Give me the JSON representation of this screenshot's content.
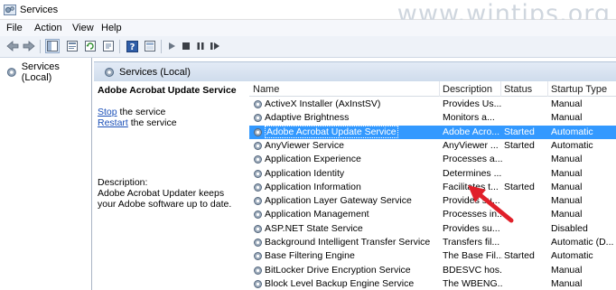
{
  "window": {
    "title": "Services",
    "watermark": "www.wintips.org"
  },
  "menu": {
    "items": [
      "File",
      "Action",
      "View",
      "Help"
    ]
  },
  "toolbar": {
    "buttons": [
      "back-icon",
      "forward-icon",
      "show-hide-tree-icon",
      "properties-icon",
      "refresh-icon",
      "export-list-icon",
      "help-icon",
      "console-tree-icon",
      "start-service-icon",
      "stop-service-icon",
      "pause-service-icon",
      "restart-service-icon"
    ]
  },
  "tree": {
    "root_label": "Services (Local)"
  },
  "main": {
    "header": "Services (Local)",
    "detail": {
      "service_title": "Adobe Acrobat Update Service",
      "stop_link": "Stop",
      "stop_suffix": " the service",
      "restart_link": "Restart",
      "restart_suffix": " the service",
      "description_label": "Description:",
      "description": "Adobe Acrobat Updater keeps your Adobe software up to date."
    },
    "columns": {
      "name": "Name",
      "description": "Description",
      "status": "Status",
      "startup": "Startup Type"
    },
    "rows": [
      {
        "name": "ActiveX Installer (AxInstSV)",
        "description": "Provides Us...",
        "status": "",
        "startup": "Manual"
      },
      {
        "name": "Adaptive Brightness",
        "description": "Monitors a...",
        "status": "",
        "startup": "Manual"
      },
      {
        "name": "Adobe Acrobat Update Service",
        "description": "Adobe Acro...",
        "status": "Started",
        "startup": "Automatic",
        "selected": true
      },
      {
        "name": "AnyViewer Service",
        "description": "AnyViewer ...",
        "status": "Started",
        "startup": "Automatic"
      },
      {
        "name": "Application Experience",
        "description": "Processes a...",
        "status": "",
        "startup": "Manual"
      },
      {
        "name": "Application Identity",
        "description": "Determines ...",
        "status": "",
        "startup": "Manual"
      },
      {
        "name": "Application Information",
        "description": "Facilitates t...",
        "status": "Started",
        "startup": "Manual"
      },
      {
        "name": "Application Layer Gateway Service",
        "description": "Provides su...",
        "status": "",
        "startup": "Manual"
      },
      {
        "name": "Application Management",
        "description": "Processes in...",
        "status": "",
        "startup": "Manual"
      },
      {
        "name": "ASP.NET State Service",
        "description": "Provides su...",
        "status": "",
        "startup": "Disabled"
      },
      {
        "name": "Background Intelligent Transfer Service",
        "description": "Transfers fil...",
        "status": "",
        "startup": "Automatic (D..."
      },
      {
        "name": "Base Filtering Engine",
        "description": "The Base Fil...",
        "status": "Started",
        "startup": "Automatic"
      },
      {
        "name": "BitLocker Drive Encryption Service",
        "description": "BDESVC hos...",
        "status": "",
        "startup": "Manual"
      },
      {
        "name": "Block Level Backup Engine Service",
        "description": "The WBENG...",
        "status": "",
        "startup": "Manual"
      }
    ]
  },
  "colors": {
    "selection": "#3399ff",
    "link": "#1a4fb8",
    "arrow": "#e0202a"
  }
}
